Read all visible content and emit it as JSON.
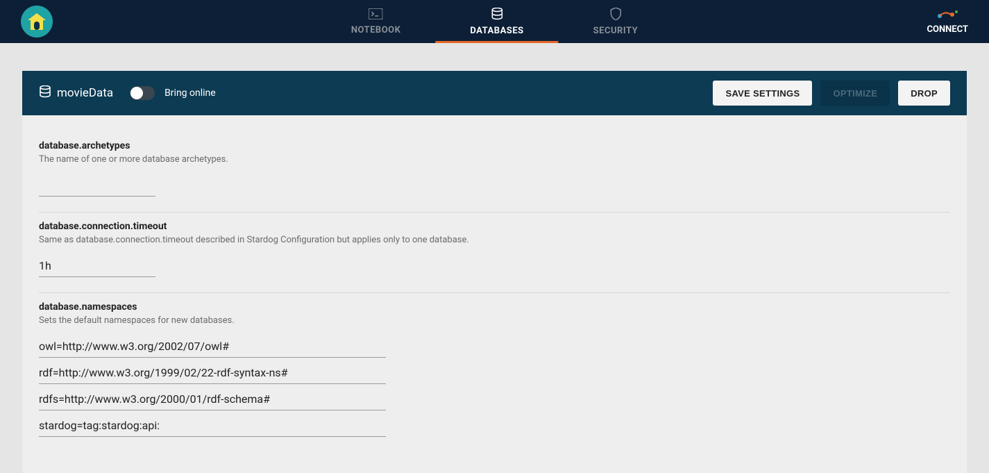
{
  "nav": {
    "notebook": "NOTEBOOK",
    "databases": "DATABASES",
    "security": "SECURITY",
    "connect": "CONNECT"
  },
  "header": {
    "dbName": "movieData",
    "toggleLabel": "Bring online",
    "saveSettings": "SAVE SETTINGS",
    "optimize": "OPTIMIZE",
    "drop": "DROP"
  },
  "settings": {
    "archetypes": {
      "name": "database.archetypes",
      "desc": "The name of one or more database archetypes.",
      "value": ""
    },
    "timeout": {
      "name": "database.connection.timeout",
      "desc": "Same as database.connection.timeout described in Stardog Configuration but applies only to one database.",
      "value": "1h"
    },
    "namespaces": {
      "name": "database.namespaces",
      "desc": "Sets the default namespaces for new databases.",
      "values": [
        "owl=http://www.w3.org/2002/07/owl#",
        "rdf=http://www.w3.org/1999/02/22-rdf-syntax-ns#",
        "rdfs=http://www.w3.org/2000/01/rdf-schema#",
        "stardog=tag:stardog:api:"
      ]
    }
  }
}
